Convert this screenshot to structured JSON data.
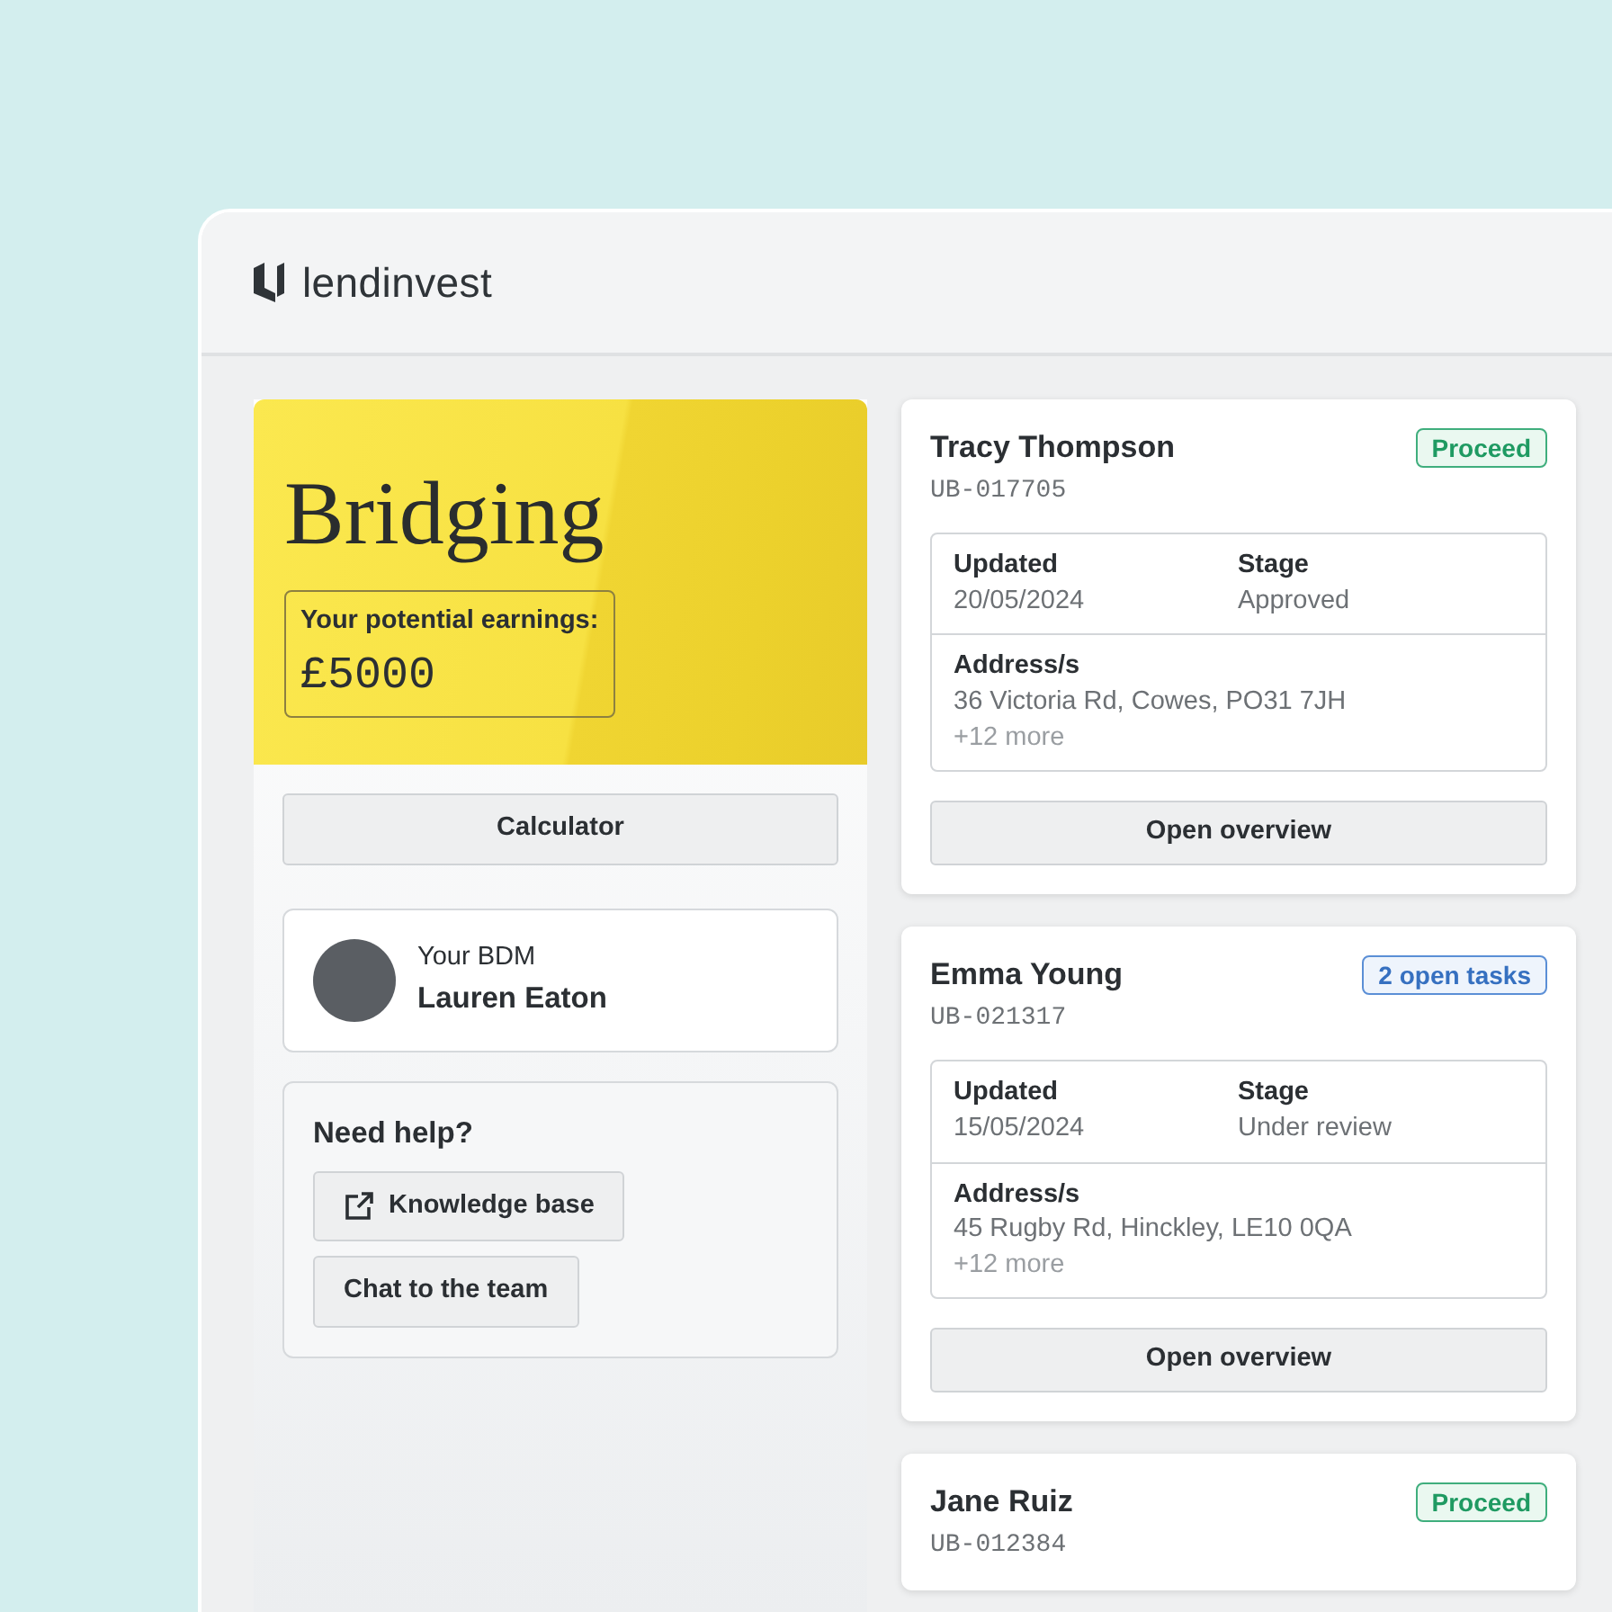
{
  "app": {
    "logo_text": "lendinvest"
  },
  "product": {
    "title": "Bridging",
    "earnings_label": "Your potential earnings:",
    "earnings_value": "£5000",
    "button": "Calculator"
  },
  "bdm": {
    "caption": "Your BDM",
    "name": "Lauren Eaton"
  },
  "help": {
    "title": "Need help?",
    "buttons": [
      {
        "label": "Knowledge base",
        "kind": "external"
      },
      {
        "label": "Chat to the team",
        "kind": "plain"
      }
    ]
  },
  "cases": [
    {
      "name": "Tracy Thompson",
      "reference": "UB-017705",
      "status": {
        "label": "Proceed",
        "kind": "proceed"
      },
      "details": {
        "updated_label": "Updated",
        "updated": "20/05/2024",
        "stage_label": "Stage",
        "stage": "Approved",
        "address_label": "Address/s",
        "address": "36 Victoria Rd, Cowes, PO31 7JH",
        "more": "+12 more"
      },
      "button": "Open overview"
    },
    {
      "name": "Emma Young",
      "reference": "UB-021317",
      "status": {
        "label": "2 open tasks",
        "kind": "tasks"
      },
      "details": {
        "updated_label": "Updated",
        "updated": "15/05/2024",
        "stage_label": "Stage",
        "stage": "Under review",
        "address_label": "Address/s",
        "address": "45 Rugby Rd, Hinckley, LE10 0QA",
        "more": "+12 more"
      },
      "button": "Open overview"
    },
    {
      "name": "Jane Ruiz",
      "reference": "UB-012384",
      "status": {
        "label": "Proceed",
        "kind": "proceed"
      }
    }
  ]
}
